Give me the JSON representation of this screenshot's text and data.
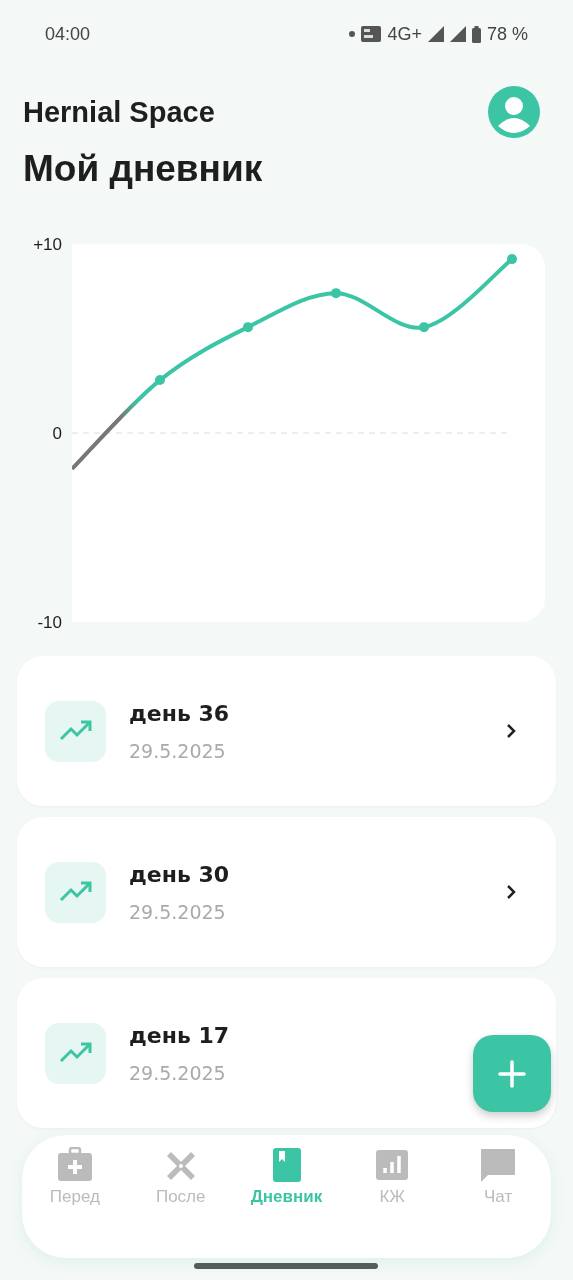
{
  "status_bar": {
    "time": "04:00",
    "network": "4G+",
    "battery": "78 %"
  },
  "app_title": "Hernial Space",
  "page_title": "Мой дневник",
  "chart": {
    "chart_data": {
      "type": "line",
      "ylim": [
        -10,
        10
      ],
      "yticks": [
        {
          "value": 10,
          "label": "+10"
        },
        0,
        -10
      ],
      "series": [
        {
          "color": "#3cc5a4",
          "marker": "circle",
          "values": [
            -1.9,
            2.8,
            5.6,
            7.4,
            5.6,
            9.2
          ]
        }
      ]
    }
  },
  "entries": [
    {
      "title": "день 36",
      "date": "29.5.2025"
    },
    {
      "title": "день 30",
      "date": "29.5.2025"
    },
    {
      "title": "день 17",
      "date": "29.5.2025"
    }
  ],
  "nav": [
    {
      "label": "Перед",
      "selected": false
    },
    {
      "label": "После",
      "selected": false
    },
    {
      "label": "Дневник",
      "selected": true
    },
    {
      "label": "КЖ",
      "selected": false
    },
    {
      "label": "Чат",
      "selected": false
    }
  ]
}
